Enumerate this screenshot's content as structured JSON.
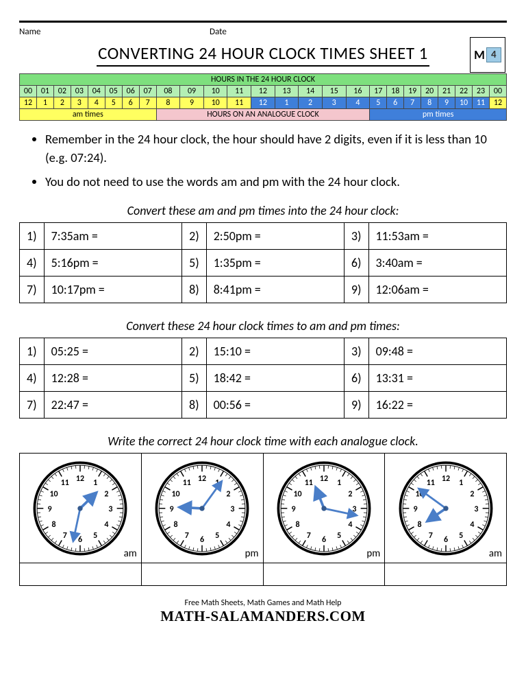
{
  "header": {
    "name_label": "Name",
    "date_label": "Date"
  },
  "title": "CONVERTING 24 HOUR CLOCK TIMES SHEET 1",
  "logo_number": "4",
  "hour_table": {
    "caption": "HOURS IN THE 24 HOUR CLOCK",
    "row24": [
      "00",
      "01",
      "02",
      "03",
      "04",
      "05",
      "06",
      "07",
      "08",
      "09",
      "10",
      "11",
      "12",
      "13",
      "14",
      "15",
      "16",
      "17",
      "18",
      "19",
      "20",
      "21",
      "22",
      "23",
      "00"
    ],
    "row12": [
      "12",
      "1",
      "2",
      "3",
      "4",
      "5",
      "6",
      "7",
      "8",
      "9",
      "10",
      "11",
      "12",
      "1",
      "2",
      "3",
      "4",
      "5",
      "6",
      "7",
      "8",
      "9",
      "10",
      "11",
      "12"
    ],
    "legend_am": "am times",
    "legend_analogue": "HOURS ON AN ANALOGUE CLOCK",
    "legend_pm": "pm times"
  },
  "bullets": [
    "Remember in the 24 hour clock, the hour should have 2 digits, even if it is less than 10 (e.g. 07:24).",
    "You do not need to use the words am and pm with the 24 hour clock."
  ],
  "section1": {
    "caption": "Convert these am and pm times into the 24 hour clock:",
    "items": [
      {
        "n": "1)",
        "v": "7:35am ="
      },
      {
        "n": "2)",
        "v": "2:50pm ="
      },
      {
        "n": "3)",
        "v": "11:53am ="
      },
      {
        "n": "4)",
        "v": "5:16pm ="
      },
      {
        "n": "5)",
        "v": "1:35pm ="
      },
      {
        "n": "6)",
        "v": "3:40am ="
      },
      {
        "n": "7)",
        "v": "10:17pm ="
      },
      {
        "n": "8)",
        "v": "8:41pm ="
      },
      {
        "n": "9)",
        "v": "12:06am ="
      }
    ]
  },
  "section2": {
    "caption": "Convert these 24 hour clock times to am and pm times:",
    "items": [
      {
        "n": "1)",
        "v": "05:25 ="
      },
      {
        "n": "2)",
        "v": "15:10 ="
      },
      {
        "n": "3)",
        "v": "09:48 ="
      },
      {
        "n": "4)",
        "v": "12:28 ="
      },
      {
        "n": "5)",
        "v": "18:42 ="
      },
      {
        "n": "6)",
        "v": "13:31 ="
      },
      {
        "n": "7)",
        "v": "22:47 ="
      },
      {
        "n": "8)",
        "v": "00:56 ="
      },
      {
        "n": "9)",
        "v": "16:22 ="
      }
    ]
  },
  "section3": {
    "caption": "Write the correct 24 hour clock time with each analogue clock.",
    "clocks": [
      {
        "hour": 1,
        "minute": 32,
        "ampm": "am"
      },
      {
        "hour": 9,
        "minute": 6,
        "ampm": "pm"
      },
      {
        "hour": 11,
        "minute": 17,
        "ampm": "pm"
      },
      {
        "hour": 7,
        "minute": 51,
        "ampm": "am"
      }
    ]
  },
  "footer": {
    "line1": "Free Math Sheets, Math Games and Math Help",
    "line2": "MATH-SALAMANDERS.COM"
  }
}
